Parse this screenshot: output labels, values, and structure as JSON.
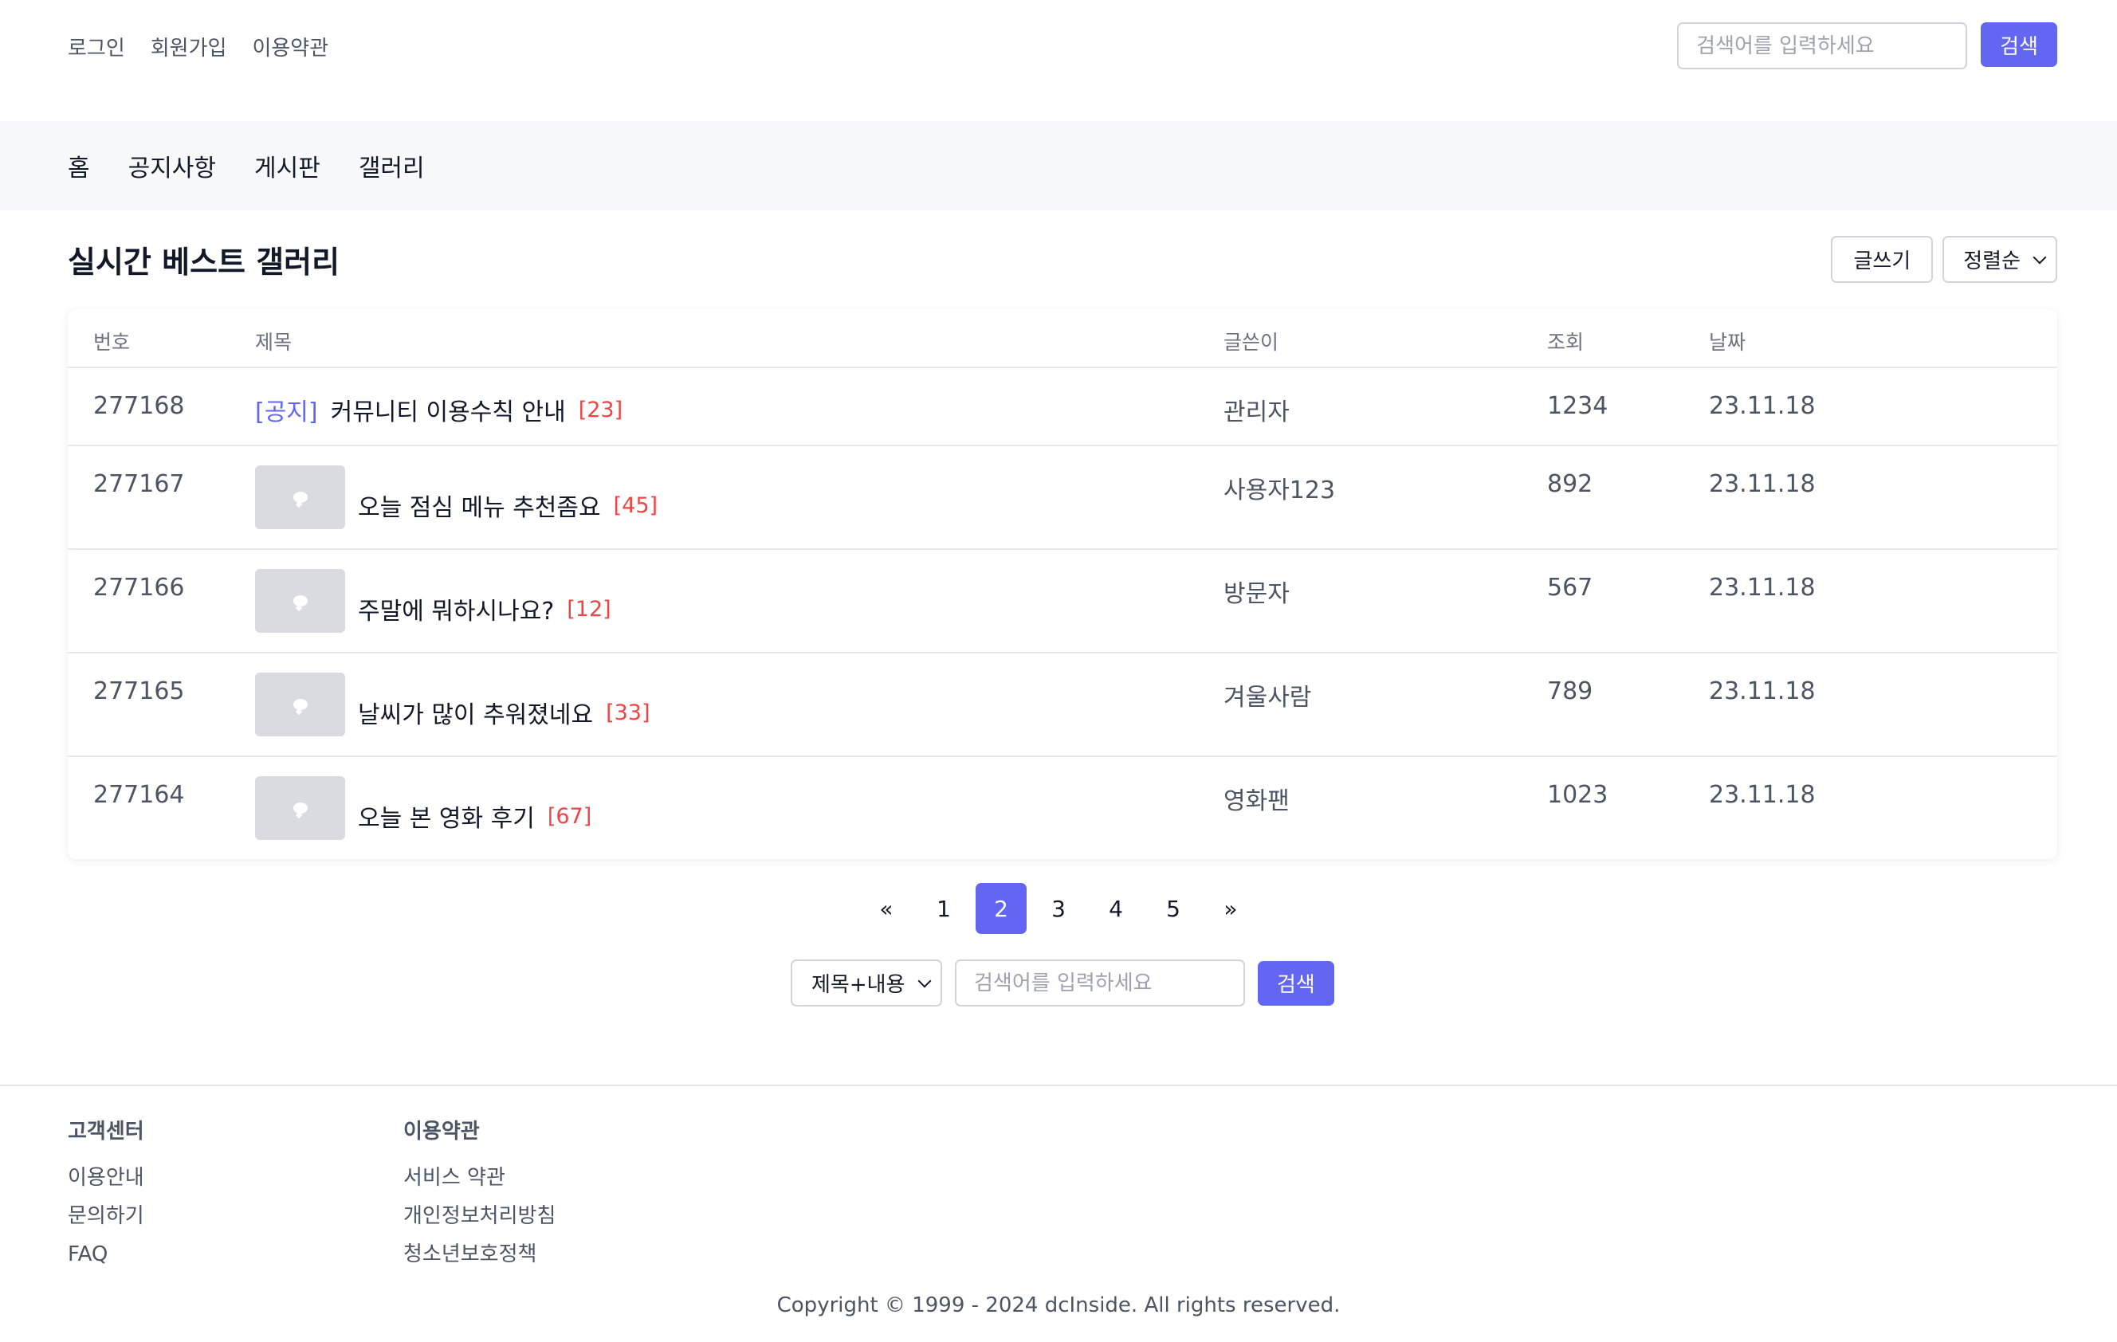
{
  "header": {
    "links": [
      "로그인",
      "회원가입",
      "이용약관"
    ],
    "search_placeholder": "검색어를 입력하세요",
    "search_button": "검색"
  },
  "nav": {
    "items": [
      "홈",
      "공지사항",
      "게시판",
      "갤러리"
    ]
  },
  "page": {
    "title": "실시간 베스트 갤러리",
    "write_button": "글쓰기",
    "sort_label": "정렬순"
  },
  "table": {
    "headers": {
      "num": "번호",
      "title": "제목",
      "author": "글쓴이",
      "views": "조회",
      "date": "날짜"
    },
    "rows": [
      {
        "num": "277168",
        "badge": "[공지]",
        "title": "커뮤니티 이용수칙 안내",
        "comments": "[23]",
        "author": "관리자",
        "views": "1234",
        "date": "23.11.18"
      },
      {
        "num": "277167",
        "title": "오늘 점심 메뉴 추천좀요",
        "comments": "[45]",
        "author": "사용자123",
        "views": "892",
        "date": "23.11.18"
      },
      {
        "num": "277166",
        "title": "주말에 뭐하시나요?",
        "comments": "[12]",
        "author": "방문자",
        "views": "567",
        "date": "23.11.18"
      },
      {
        "num": "277165",
        "title": "날씨가 많이 추워졌네요",
        "comments": "[33]",
        "author": "겨울사람",
        "views": "789",
        "date": "23.11.18"
      },
      {
        "num": "277164",
        "title": "오늘 본 영화 후기",
        "comments": "[67]",
        "author": "영화팬",
        "views": "1023",
        "date": "23.11.18"
      }
    ]
  },
  "pagination": {
    "prev": "«",
    "pages": [
      "1",
      "2",
      "3",
      "4",
      "5"
    ],
    "current": "2",
    "next": "»"
  },
  "bottom_search": {
    "scope": "제목+내용",
    "placeholder": "검색어를 입력하세요",
    "button": "검색"
  },
  "footer": {
    "col1": {
      "title": "고객센터",
      "links": [
        "이용안내",
        "문의하기",
        "FAQ"
      ]
    },
    "col2": {
      "title": "이용약관",
      "links": [
        "서비스 약관",
        "개인정보처리방침",
        "청소년보호정책"
      ]
    },
    "copyright": "Copyright © 1999 - 2024 dcInside. All rights reserved."
  },
  "colors": {
    "accent": "#6366f1",
    "comment": "#ef4444"
  }
}
